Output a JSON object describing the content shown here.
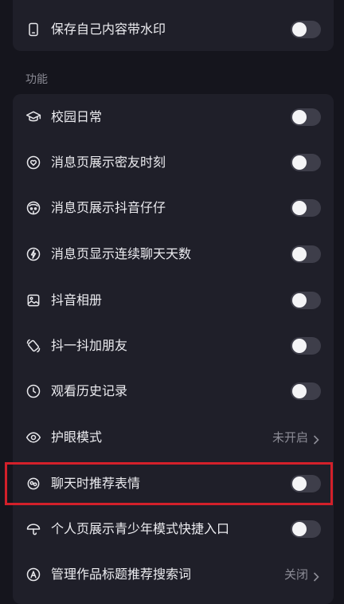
{
  "top_card": {
    "rows": [
      {
        "label": "保存自己内容带水印",
        "icon": "phone-icon",
        "control": "toggle",
        "on": false
      }
    ]
  },
  "section": {
    "label": "功能"
  },
  "main_card": {
    "rows": [
      {
        "label": "校园日常",
        "icon": "graduation-cap-icon",
        "control": "toggle",
        "on": false
      },
      {
        "label": "消息页展示密友时刻",
        "icon": "heart-circle-icon",
        "control": "toggle",
        "on": false
      },
      {
        "label": "消息页展示抖音仔仔",
        "icon": "mascot-icon",
        "control": "toggle",
        "on": false
      },
      {
        "label": "消息页显示连续聊天天数",
        "icon": "flame-icon",
        "control": "toggle",
        "on": false
      },
      {
        "label": "抖音相册",
        "icon": "image-icon",
        "control": "toggle",
        "on": false
      },
      {
        "label": "抖一抖加朋友",
        "icon": "shake-phone-icon",
        "control": "toggle",
        "on": false
      },
      {
        "label": "观看历史记录",
        "icon": "clock-icon",
        "control": "toggle",
        "on": false
      },
      {
        "label": "护眼模式",
        "icon": "eye-icon",
        "control": "value",
        "value": "未开启"
      },
      {
        "label": "聊天时推荐表情",
        "icon": "sticker-icon",
        "control": "toggle",
        "on": false
      },
      {
        "label": "个人页展示青少年模式快捷入口",
        "icon": "umbrella-icon",
        "control": "toggle",
        "on": false
      },
      {
        "label": "管理作品标题推荐搜索词",
        "icon": "letter-a-icon",
        "control": "value",
        "value": "关闭"
      }
    ]
  },
  "colors": {
    "background": "#15151d",
    "card": "#1f1f29",
    "highlight": "#d3202a",
    "toggle_off": "#3e3e4a"
  }
}
